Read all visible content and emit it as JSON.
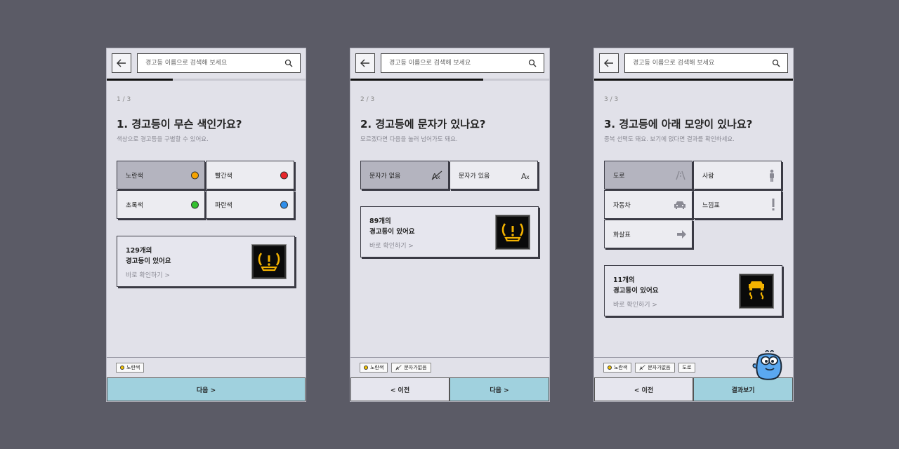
{
  "search_placeholder": "경고등 이름으로 검색해 보세요",
  "screens": [
    {
      "step": "1 / 3",
      "question": "1. 경고등이 무슨 색인가요?",
      "hint": "색상으로 경고등을 구별할 수 있어요.",
      "progress": 0.33,
      "options": [
        {
          "label": "노란색",
          "selected": true,
          "icon": "yellow-dot",
          "color": "#f5a300"
        },
        {
          "label": "빨간색",
          "selected": false,
          "icon": "red-dot",
          "color": "#e8262a"
        },
        {
          "label": "초록색",
          "selected": false,
          "icon": "green-dot",
          "color": "#33c02f"
        },
        {
          "label": "파란색",
          "selected": false,
          "icon": "blue-dot",
          "color": "#2f8eea"
        }
      ],
      "result": {
        "count_line1": "129개의",
        "count_line2": "경고등이 있어요",
        "link": "바로 확인하기 >",
        "icon": "tire-pressure-warning-icon"
      },
      "chips": [
        "노란색"
      ],
      "buttons": {
        "next": "다음 >"
      }
    },
    {
      "step": "2 / 3",
      "question": "2. 경고등에 문자가 있나요?",
      "hint": "모르겠다면 다음을 눌러 넘어가도 돼요.",
      "progress": 0.67,
      "options": [
        {
          "label": "문자가 없음",
          "selected": true,
          "icon": "no-letters-icon"
        },
        {
          "label": "문자가 있음",
          "selected": false,
          "icon": "letters-icon"
        }
      ],
      "result": {
        "count_line1": "89개의",
        "count_line2": "경고등이 있어요",
        "link": "바로 확인하기 >",
        "icon": "tire-pressure-warning-icon"
      },
      "chips": [
        "노란색",
        "문자가없음"
      ],
      "buttons": {
        "prev": "< 이전",
        "next": "다음 >"
      }
    },
    {
      "step": "3 / 3",
      "question": "3. 경고등에 아래 모양이 있나요?",
      "hint": "중복 선택도 돼요. 보기에 없다면 결과를 확인하세요.",
      "progress": 1.0,
      "options": [
        {
          "label": "도로",
          "selected": true,
          "icon": "road-icon"
        },
        {
          "label": "사람",
          "selected": false,
          "icon": "person-icon"
        },
        {
          "label": "자동차",
          "selected": false,
          "icon": "car-icon"
        },
        {
          "label": "느낌표",
          "selected": false,
          "icon": "exclamation-icon"
        },
        {
          "label": "화살표",
          "selected": false,
          "icon": "arrow-icon"
        }
      ],
      "result": {
        "count_line1": "11개의",
        "count_line2": "경고등이 있어요",
        "link": "바로 확인하기 >",
        "icon": "skid-control-warning-icon"
      },
      "chips": [
        "노란색",
        "문자가없음",
        "도로"
      ],
      "buttons": {
        "prev": "< 이전",
        "next": "결과보기"
      }
    }
  ],
  "colors": {
    "background": "#5b5b66",
    "screen": "#e1e1e9",
    "selected": "#b4b4bf",
    "next_button": "#a0d1de",
    "warning_amber": "#f3b200"
  }
}
